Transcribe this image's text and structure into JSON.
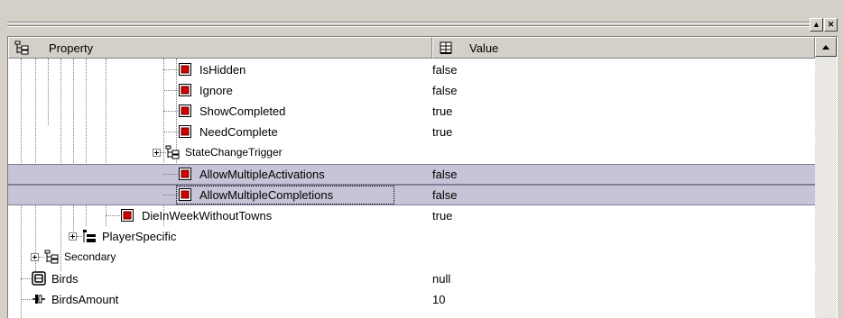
{
  "window": {
    "buttons": [
      "▲",
      "✕"
    ]
  },
  "header": {
    "property_label": "Property",
    "value_label": "Value"
  },
  "rows": [
    {
      "name": "IsHidden",
      "value": "false",
      "icon": "property-red-icon"
    },
    {
      "name": "Ignore",
      "value": "false",
      "icon": "property-red-icon"
    },
    {
      "name": "ShowCompleted",
      "value": "true",
      "icon": "property-red-icon"
    },
    {
      "name": "NeedComplete",
      "value": "true",
      "icon": "property-red-icon"
    },
    {
      "name": "StateChangeTrigger",
      "value": "",
      "icon": "group-icon"
    },
    {
      "name": "AllowMultipleActivations",
      "value": "false",
      "icon": "property-red-icon",
      "selected": true
    },
    {
      "name": "AllowMultipleCompletions",
      "value": "false",
      "icon": "property-red-icon",
      "selected": true
    },
    {
      "name": "DieInWeekWithoutTowns",
      "value": "true",
      "icon": "property-red-icon"
    },
    {
      "name": "PlayerSpecific",
      "value": "",
      "icon": "folder-group-icon"
    },
    {
      "name": "Secondary",
      "value": "",
      "icon": "group-icon"
    },
    {
      "name": "Birds",
      "value": "null",
      "icon": "object-icon"
    },
    {
      "name": "BirdsAmount",
      "value": "10",
      "icon": "numeric-icon"
    }
  ],
  "colors": {
    "selection": "#c6c4d6",
    "chrome": "#d4d0c8"
  }
}
